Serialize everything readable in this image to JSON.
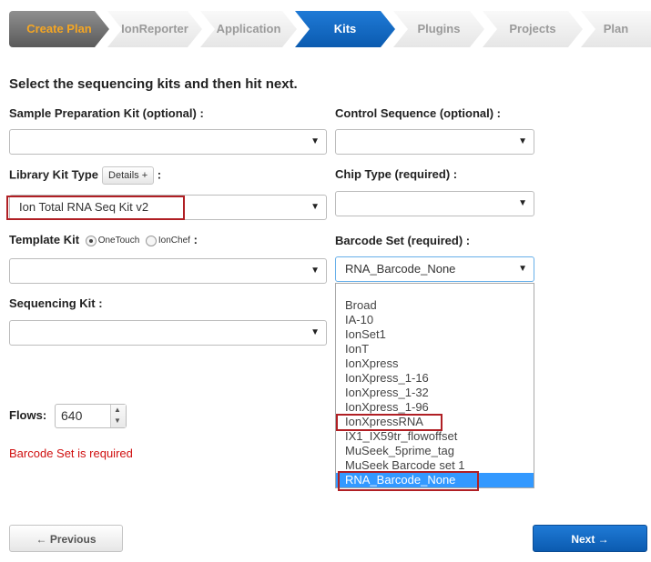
{
  "wizard": {
    "steps": [
      "Create Plan",
      "IonReporter",
      "Application",
      "Kits",
      "Plugins",
      "Projects",
      "Plan"
    ]
  },
  "instruction": "Select the sequencing kits and then hit next.",
  "form": {
    "sample_prep": {
      "label": "Sample Preparation Kit (optional) :",
      "value": ""
    },
    "control_seq": {
      "label": "Control Sequence (optional) :",
      "value": ""
    },
    "library_kit": {
      "label": "Library Kit Type",
      "details_label": "Details +",
      "suffix": ":",
      "value": "Ion Total RNA Seq Kit v2"
    },
    "chip_type": {
      "label": "Chip Type (required) :",
      "value": ""
    },
    "template_kit": {
      "label": "Template Kit",
      "option_onetouch": "OneTouch",
      "option_ionchef": "IonChef",
      "suffix": ":",
      "value": ""
    },
    "barcode_set": {
      "label": "Barcode Set (required) :",
      "value": "RNA_Barcode_None",
      "options": [
        "Broad",
        "IA-10",
        "IonSet1",
        "IonT",
        "IonXpress",
        "IonXpress_1-16",
        "IonXpress_1-32",
        "IonXpress_1-96",
        "IonXpressRNA",
        "IX1_IX59tr_flowoffset",
        "MuSeek_5prime_tag",
        "MuSeek Barcode set 1",
        "RNA_Barcode_None"
      ]
    },
    "sequencing_kit": {
      "label": "Sequencing Kit :",
      "value": ""
    },
    "flows": {
      "label": "Flows:",
      "value": "640"
    },
    "error": "Barcode Set is required"
  },
  "buttons": {
    "previous": "← Previous",
    "next": "Next →"
  },
  "icons": {
    "dropdown_arrow": "▼",
    "spin_up": "▲",
    "spin_down": "▼"
  },
  "colors": {
    "accent": "#0b5bb0",
    "done_text": "#f5a623",
    "highlight": "#b01f24",
    "error": "#d01010",
    "selection": "#3399ff"
  }
}
